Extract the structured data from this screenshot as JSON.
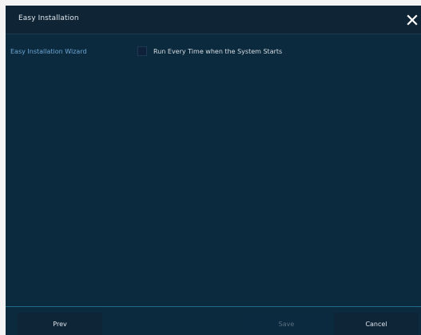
{
  "dialog": {
    "title": "Easy Installation",
    "close_icon": "close-icon"
  },
  "content": {
    "wizard_label": "Easy Installation Wizard",
    "run_every_time": {
      "label": "Run Every Time when the System Starts",
      "checked": false
    }
  },
  "footer": {
    "prev_label": "Prev",
    "save_label": "Save",
    "cancel_label": "Cancel",
    "save_disabled": true
  },
  "colors": {
    "dialog_bg": "#0b2a3d",
    "titlebar_bg": "#0f2434",
    "accent_label": "#6fa6d6",
    "divider": "#1f6a88"
  }
}
